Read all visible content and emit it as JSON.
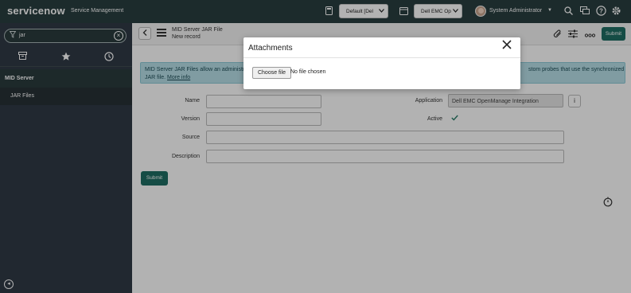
{
  "header": {
    "logo": "servicenow",
    "app_name": "Service Management",
    "scope_select": "Default [Del",
    "app_select": "Dell EMC Op",
    "user_name": "System Administrator"
  },
  "sidebar": {
    "filter_value": "jar",
    "app_item": "MID Server",
    "module_item": "JAR Files"
  },
  "form": {
    "title": "MID Server JAR File",
    "subtitle": "New record",
    "submit_top": "Submit",
    "info_line1": "MID Server JAR Files allow an administr",
    "info_line1_right": "stom probes that use the synchronized",
    "info_line2": "JAR file.",
    "info_link": "More info",
    "fields": {
      "name_label": "Name",
      "version_label": "Version",
      "source_label": "Source",
      "description_label": "Description",
      "application_label": "Application",
      "application_value": "Dell EMC OpenManage Integration",
      "active_label": "Active"
    },
    "submit_bottom": "Submit"
  },
  "modal": {
    "title": "Attachments",
    "choose_button": "Choose file",
    "no_file_text": "No file chosen"
  },
  "icons": {
    "active_checkbox": "check-icon",
    "close": "close-icon"
  },
  "colors": {
    "header_bg": "#293e40",
    "sidebar_bg": "#303a46",
    "submit_bg": "#1f6e63",
    "info_bg": "#b8e0e8"
  }
}
